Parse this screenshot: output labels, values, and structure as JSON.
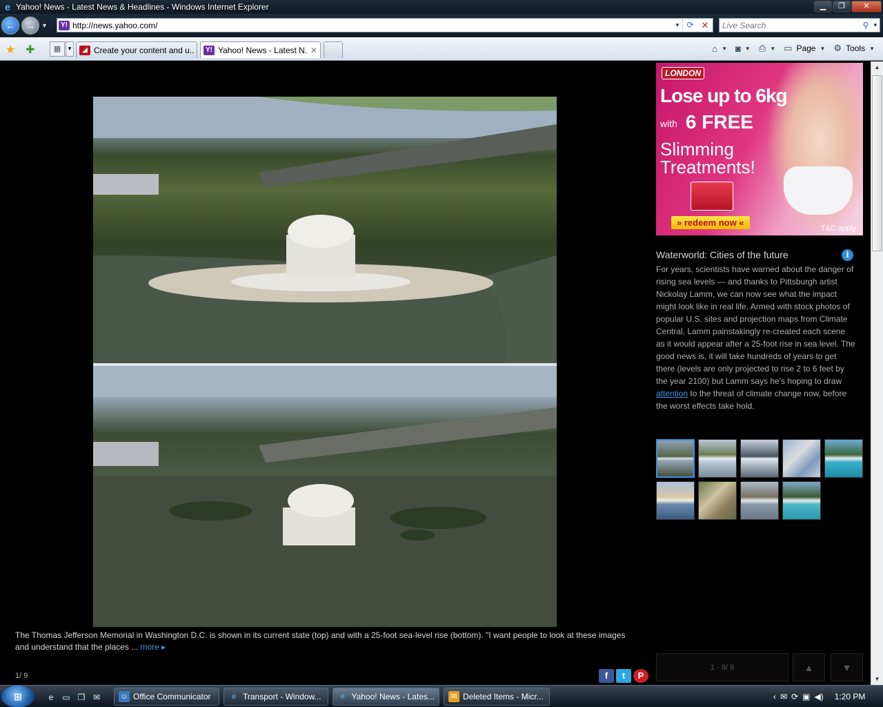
{
  "window": {
    "title": "Yahoo! News - Latest News & Headlines - Windows Internet Explorer",
    "controls": {
      "minimize": "▁",
      "maximize": "❐",
      "close": "✕"
    }
  },
  "address_bar": {
    "url": "http://news.yahoo.com/",
    "search_placeholder": "Live Search"
  },
  "tabs": [
    {
      "label": "Create your content and u..."
    },
    {
      "label": "Yahoo! News - Latest N..."
    }
  ],
  "command_bar": {
    "page_label": "Page",
    "tools_label": "Tools"
  },
  "slideshow": {
    "caption": "The Thomas Jefferson Memorial in Washington D.C. is shown in its current state (top) and with a 25-foot sea-level rise (bottom). \"I want people to look at these images and understand that the places ...",
    "more_label": "more",
    "counter": "1/ 9",
    "pager_label": "1 - 9/ 9"
  },
  "ad": {
    "brand": "LONDON",
    "line1": "Lose up to 6kg",
    "with": "with",
    "line2": "6 FREE",
    "line3a": "Slimming",
    "line3b": "Treatments!",
    "cta": "» redeem now «",
    "tc": "T&C apply"
  },
  "info": {
    "title": "Waterworld: Cities of the future",
    "body_before": "For years, scientists have warned about the danger of rising sea levels — and thanks to Pittsburgh artist Nickolay Lamm, we can now see what the impact might look like in real life. Armed with stock photos of popular U.S. sites and projection maps from Climate Central, Lamm painstakingly re-created each scene as it would appear after a 25-foot rise in sea level. The good news is, it will take hundreds of years to get there (levels are only projected to rise 2 to 6 feet by the year 2100) but Lamm says he's hoping to draw ",
    "link": "attention",
    "body_after": " to the threat of climate change now, before the worst effects take hold."
  },
  "taskbar": {
    "tasks": [
      {
        "label": "Office Communicator"
      },
      {
        "label": "Transport - Window..."
      },
      {
        "label": "Yahoo! News - Lates..."
      },
      {
        "label": "Deleted Items - Micr..."
      }
    ],
    "clock": "1:20 PM"
  },
  "colors": {
    "accent": "#4a90e0",
    "selected_thumb": "#3b8fe0"
  }
}
